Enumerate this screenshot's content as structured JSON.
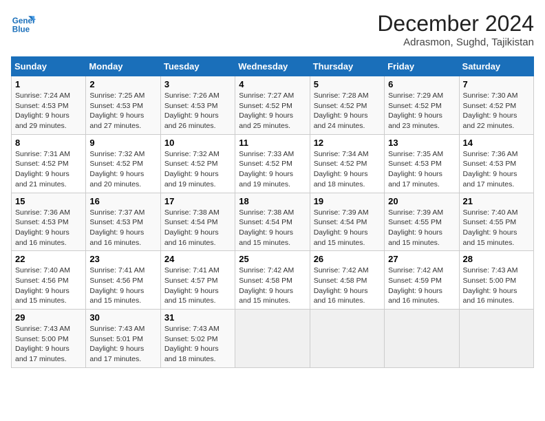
{
  "header": {
    "logo_line1": "General",
    "logo_line2": "Blue",
    "month_title": "December 2024",
    "location": "Adrasmon, Sughd, Tajikistan"
  },
  "columns": [
    "Sunday",
    "Monday",
    "Tuesday",
    "Wednesday",
    "Thursday",
    "Friday",
    "Saturday"
  ],
  "weeks": [
    [
      {
        "day": "1",
        "sunrise": "7:24 AM",
        "sunset": "4:53 PM",
        "daylight": "9 hours and 29 minutes."
      },
      {
        "day": "2",
        "sunrise": "7:25 AM",
        "sunset": "4:53 PM",
        "daylight": "9 hours and 27 minutes."
      },
      {
        "day": "3",
        "sunrise": "7:26 AM",
        "sunset": "4:53 PM",
        "daylight": "9 hours and 26 minutes."
      },
      {
        "day": "4",
        "sunrise": "7:27 AM",
        "sunset": "4:52 PM",
        "daylight": "9 hours and 25 minutes."
      },
      {
        "day": "5",
        "sunrise": "7:28 AM",
        "sunset": "4:52 PM",
        "daylight": "9 hours and 24 minutes."
      },
      {
        "day": "6",
        "sunrise": "7:29 AM",
        "sunset": "4:52 PM",
        "daylight": "9 hours and 23 minutes."
      },
      {
        "day": "7",
        "sunrise": "7:30 AM",
        "sunset": "4:52 PM",
        "daylight": "9 hours and 22 minutes."
      }
    ],
    [
      {
        "day": "8",
        "sunrise": "7:31 AM",
        "sunset": "4:52 PM",
        "daylight": "9 hours and 21 minutes."
      },
      {
        "day": "9",
        "sunrise": "7:32 AM",
        "sunset": "4:52 PM",
        "daylight": "9 hours and 20 minutes."
      },
      {
        "day": "10",
        "sunrise": "7:32 AM",
        "sunset": "4:52 PM",
        "daylight": "9 hours and 19 minutes."
      },
      {
        "day": "11",
        "sunrise": "7:33 AM",
        "sunset": "4:52 PM",
        "daylight": "9 hours and 19 minutes."
      },
      {
        "day": "12",
        "sunrise": "7:34 AM",
        "sunset": "4:52 PM",
        "daylight": "9 hours and 18 minutes."
      },
      {
        "day": "13",
        "sunrise": "7:35 AM",
        "sunset": "4:53 PM",
        "daylight": "9 hours and 17 minutes."
      },
      {
        "day": "14",
        "sunrise": "7:36 AM",
        "sunset": "4:53 PM",
        "daylight": "9 hours and 17 minutes."
      }
    ],
    [
      {
        "day": "15",
        "sunrise": "7:36 AM",
        "sunset": "4:53 PM",
        "daylight": "9 hours and 16 minutes."
      },
      {
        "day": "16",
        "sunrise": "7:37 AM",
        "sunset": "4:53 PM",
        "daylight": "9 hours and 16 minutes."
      },
      {
        "day": "17",
        "sunrise": "7:38 AM",
        "sunset": "4:54 PM",
        "daylight": "9 hours and 16 minutes."
      },
      {
        "day": "18",
        "sunrise": "7:38 AM",
        "sunset": "4:54 PM",
        "daylight": "9 hours and 15 minutes."
      },
      {
        "day": "19",
        "sunrise": "7:39 AM",
        "sunset": "4:54 PM",
        "daylight": "9 hours and 15 minutes."
      },
      {
        "day": "20",
        "sunrise": "7:39 AM",
        "sunset": "4:55 PM",
        "daylight": "9 hours and 15 minutes."
      },
      {
        "day": "21",
        "sunrise": "7:40 AM",
        "sunset": "4:55 PM",
        "daylight": "9 hours and 15 minutes."
      }
    ],
    [
      {
        "day": "22",
        "sunrise": "7:40 AM",
        "sunset": "4:56 PM",
        "daylight": "9 hours and 15 minutes."
      },
      {
        "day": "23",
        "sunrise": "7:41 AM",
        "sunset": "4:56 PM",
        "daylight": "9 hours and 15 minutes."
      },
      {
        "day": "24",
        "sunrise": "7:41 AM",
        "sunset": "4:57 PM",
        "daylight": "9 hours and 15 minutes."
      },
      {
        "day": "25",
        "sunrise": "7:42 AM",
        "sunset": "4:58 PM",
        "daylight": "9 hours and 15 minutes."
      },
      {
        "day": "26",
        "sunrise": "7:42 AM",
        "sunset": "4:58 PM",
        "daylight": "9 hours and 16 minutes."
      },
      {
        "day": "27",
        "sunrise": "7:42 AM",
        "sunset": "4:59 PM",
        "daylight": "9 hours and 16 minutes."
      },
      {
        "day": "28",
        "sunrise": "7:43 AM",
        "sunset": "5:00 PM",
        "daylight": "9 hours and 16 minutes."
      }
    ],
    [
      {
        "day": "29",
        "sunrise": "7:43 AM",
        "sunset": "5:00 PM",
        "daylight": "9 hours and 17 minutes."
      },
      {
        "day": "30",
        "sunrise": "7:43 AM",
        "sunset": "5:01 PM",
        "daylight": "9 hours and 17 minutes."
      },
      {
        "day": "31",
        "sunrise": "7:43 AM",
        "sunset": "5:02 PM",
        "daylight": "9 hours and 18 minutes."
      },
      null,
      null,
      null,
      null
    ]
  ],
  "labels": {
    "sunrise": "Sunrise:",
    "sunset": "Sunset:",
    "daylight": "Daylight:"
  }
}
